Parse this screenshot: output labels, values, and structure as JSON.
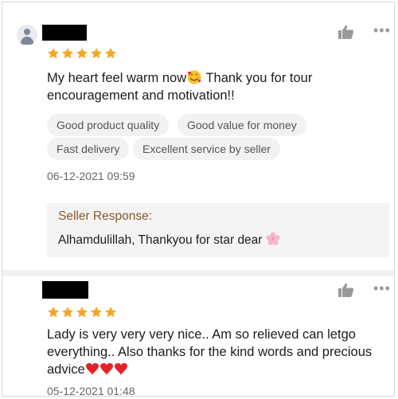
{
  "reviews": [
    {
      "rating": 5,
      "text_line1": "My heart feel warm now",
      "text_line1_after_emoji": " Thank you for tour",
      "text_line2": "encouragement and motivation!!",
      "tags": [
        "Good product quality",
        "Good value for money",
        "Fast delivery",
        "Excellent service by seller"
      ],
      "timestamp": "06-12-2021 09:59",
      "seller_response": {
        "label": "Seller Response:",
        "text": "Alhamdulillah, Thankyou for star dear"
      }
    },
    {
      "rating": 5,
      "text_line1": "Lady is very very very nice.. Am so relieved can letgo",
      "text_line2": "everything.. Also thanks for the kind words and precious",
      "text_line3": "advice",
      "timestamp": "05-12-2021 01:48"
    }
  ],
  "icons": {
    "like": "thumbs-up-icon",
    "more": "more-options-icon",
    "avatar": "user-avatar-icon",
    "star": "star-icon",
    "emoji_face": "smiling-face-with-hearts-emoji",
    "emoji_flower": "cherry-blossom-emoji",
    "emoji_heart": "red-heart-emoji"
  },
  "colors": {
    "star": "#f5a623",
    "seller_label": "#8a5a2b",
    "heart": "#e0242b"
  }
}
